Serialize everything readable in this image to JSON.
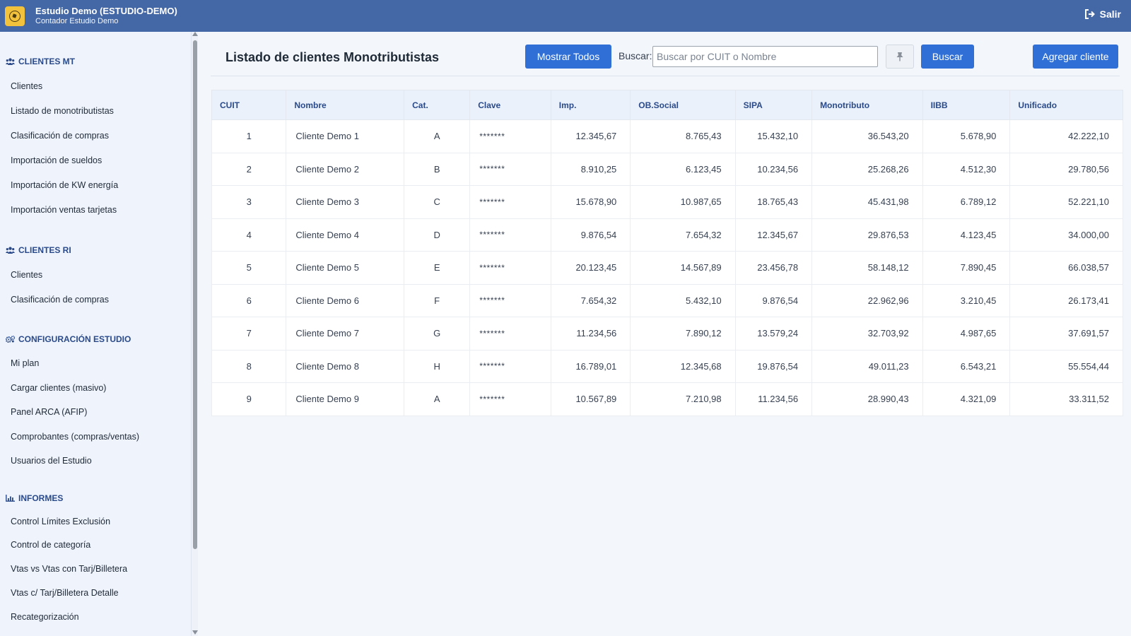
{
  "header": {
    "title": "Estudio Demo (ESTUDIO-DEMO)",
    "subtitle": "Contador Estudio Demo",
    "logout_label": "Salir"
  },
  "sidebar": {
    "sections": [
      {
        "title": "CLIENTES MT",
        "icon": "users-icon",
        "items": [
          "Clientes",
          "Listado de monotributistas",
          "Clasificación de compras",
          "Importación de sueldos",
          "Importación de KW energía",
          "Importación ventas tarjetas"
        ]
      },
      {
        "title": "CLIENTES RI",
        "icon": "users-icon",
        "items": [
          "Clientes",
          "Clasificación de compras"
        ]
      },
      {
        "title": "CONFIGURACIÓN ESTUDIO",
        "icon": "gears-icon",
        "items": [
          "Mi plan",
          "Cargar clientes (masivo)",
          "Panel ARCA (AFIP)",
          "Comprobantes (compras/ventas)",
          "Usuarios del Estudio"
        ]
      },
      {
        "title": "INFORMES",
        "icon": "chart-icon",
        "items": [
          "Control Límites Exclusión",
          "Control de categoría",
          "Vtas vs Vtas con Tarj/Billetera",
          "Vtas c/ Tarj/Billetera Detalle",
          "Recategorización"
        ]
      }
    ]
  },
  "main": {
    "title": "Listado de clientes Monotributistas",
    "show_all_label": "Mostrar Todos",
    "search_label": "Buscar:",
    "search_placeholder": "Buscar por CUIT o Nombre",
    "search_value": "",
    "search_button": "Buscar",
    "add_button": "Agregar cliente",
    "table": {
      "columns": [
        "CUIT",
        "Nombre",
        "Cat.",
        "Clave",
        "Imp.",
        "OB.Social",
        "SIPA",
        "Monotributo",
        "IIBB",
        "Unificado"
      ],
      "rows": [
        [
          "1",
          "Cliente Demo 1",
          "A",
          "*******",
          "12.345,67",
          "8.765,43",
          "15.432,10",
          "36.543,20",
          "5.678,90",
          "42.222,10"
        ],
        [
          "2",
          "Cliente Demo 2",
          "B",
          "*******",
          "8.910,25",
          "6.123,45",
          "10.234,56",
          "25.268,26",
          "4.512,30",
          "29.780,56"
        ],
        [
          "3",
          "Cliente Demo 3",
          "C",
          "*******",
          "15.678,90",
          "10.987,65",
          "18.765,43",
          "45.431,98",
          "6.789,12",
          "52.221,10"
        ],
        [
          "4",
          "Cliente Demo 4",
          "D",
          "*******",
          "9.876,54",
          "7.654,32",
          "12.345,67",
          "29.876,53",
          "4.123,45",
          "34.000,00"
        ],
        [
          "5",
          "Cliente Demo 5",
          "E",
          "*******",
          "20.123,45",
          "14.567,89",
          "23.456,78",
          "58.148,12",
          "7.890,45",
          "66.038,57"
        ],
        [
          "6",
          "Cliente Demo 6",
          "F",
          "*******",
          "7.654,32",
          "5.432,10",
          "9.876,54",
          "22.962,96",
          "3.210,45",
          "26.173,41"
        ],
        [
          "7",
          "Cliente Demo 7",
          "G",
          "*******",
          "11.234,56",
          "7.890,12",
          "13.579,24",
          "32.703,92",
          "4.987,65",
          "37.691,57"
        ],
        [
          "8",
          "Cliente Demo 8",
          "H",
          "*******",
          "16.789,01",
          "12.345,68",
          "19.876,54",
          "49.011,23",
          "6.543,21",
          "55.554,44"
        ],
        [
          "9",
          "Cliente Demo 9",
          "A",
          "*******",
          "10.567,89",
          "7.210,98",
          "11.234,56",
          "28.990,43",
          "4.321,09",
          "33.311,52"
        ]
      ]
    }
  },
  "colors": {
    "header_bg": "#4467a6",
    "accent": "#2f6fd6",
    "sidebar_bg": "#eef3fc",
    "section_text": "#2a4a8a",
    "logo_bg": "#f3c23c"
  }
}
